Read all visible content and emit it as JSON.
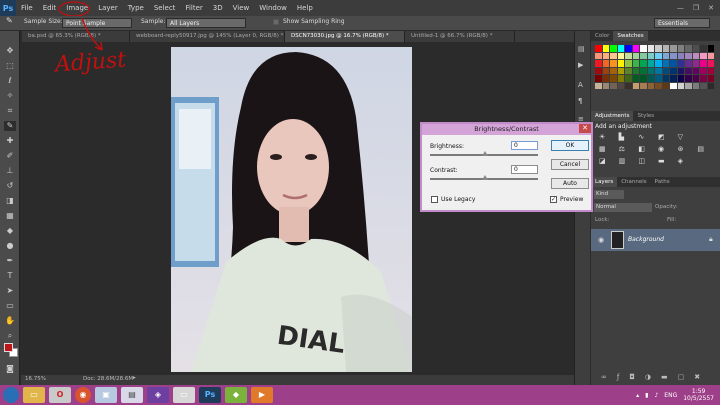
{
  "app": {
    "logo": "Ps"
  },
  "menu": [
    "File",
    "Edit",
    "Image",
    "Layer",
    "Type",
    "Select",
    "Filter",
    "3D",
    "View",
    "Window",
    "Help"
  ],
  "options_bar": {
    "sample_size_label": "Sample Size:",
    "sample_size_value": "Point Sample",
    "sample_label": "Sample:",
    "sample_value": "All Layers",
    "show_ring_label": "Show Sampling Ring",
    "workspace": "Essentials"
  },
  "doc_tabs": [
    "ba.psd @ 65.3% (RGB/8) *",
    "webboard-reply50917.jpg @ 145% (Layer 0, RGB/8) *",
    "DSCN73030.jpg @ 16.7% (RGB/8) *",
    "Untitled-1 @ 66.7% (RGB/8) *"
  ],
  "status_bar": {
    "zoom": "16.75%",
    "doc": "Doc: 28.6M/28.6M"
  },
  "annotation": {
    "text": "Adjust"
  },
  "panels": {
    "color_tab": "Color",
    "swatches_tab": "Swatches",
    "adjustments_tab": "Adjustments",
    "styles_tab": "Styles",
    "add_adjustment": "Add an adjustment",
    "layers_tab": "Layers",
    "channels_tab": "Channels",
    "paths_tab": "Paths",
    "kind_label": "Kind",
    "blend_mode": "Normal",
    "opacity_label": "Opacity:",
    "lock_label": "Lock:",
    "fill_label": "Fill:",
    "layer_name": "Background"
  },
  "dialog": {
    "title": "Brightness/Contrast",
    "brightness_label": "Brightness:",
    "brightness_value": "0",
    "contrast_label": "Contrast:",
    "contrast_value": "0",
    "use_legacy_label": "Use Legacy",
    "preview_label": "Preview",
    "ok_label": "OK",
    "cancel_label": "Cancel",
    "auto_label": "Auto",
    "brightness_level": 0.5,
    "contrast_level": 0.5
  },
  "taskbar": {
    "language": "ENG",
    "time": "1:59",
    "date": "10/5/2557",
    "ps_label": "Ps"
  },
  "colors": {
    "taskbar": "#9e3f8a",
    "dialog_border": "#c28bc9",
    "dialog_title": "#d4a4d8",
    "foreground_swatch": "#c0141b",
    "annotation": "#c01010"
  }
}
